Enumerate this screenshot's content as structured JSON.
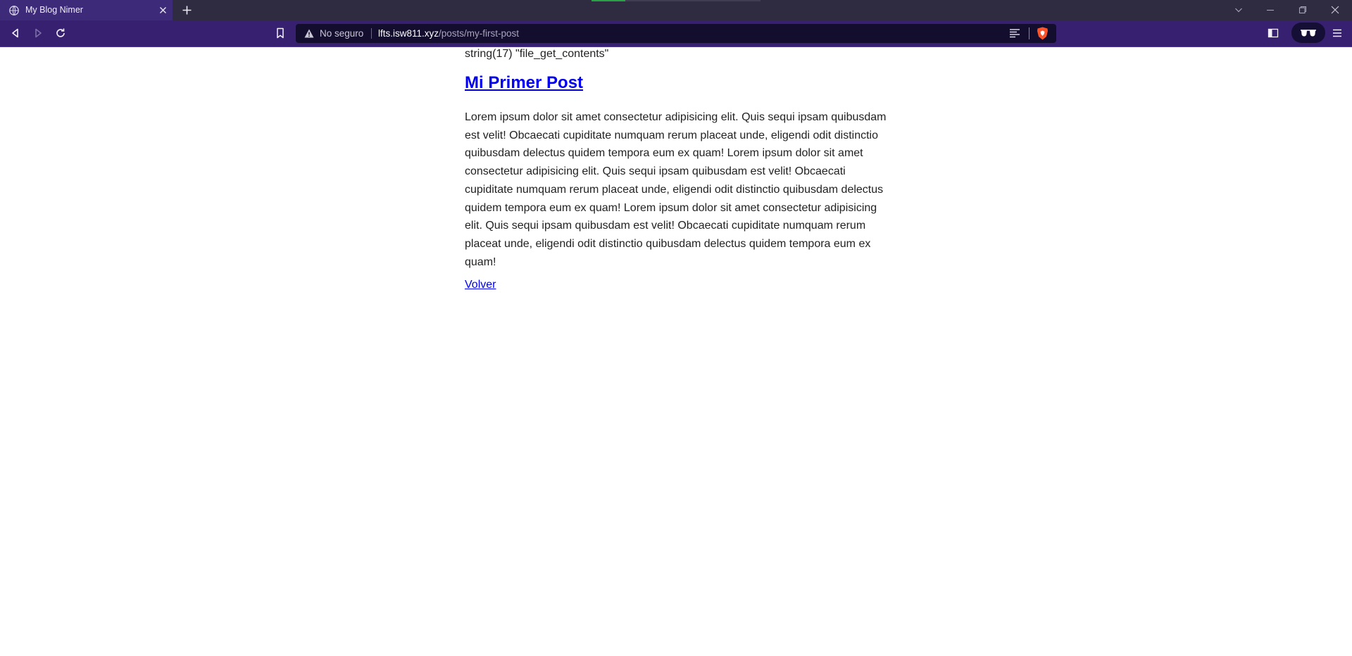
{
  "browser": {
    "tab": {
      "title": "My Blog Nimer",
      "favicon": "globe-icon"
    },
    "urlbar": {
      "security_label": "No seguro",
      "host": "lfts.isw811.xyz",
      "path": "/posts/my-first-post"
    },
    "colors": {
      "tabstrip": "#2f2c41",
      "active_tab": "#3d2a78",
      "toolbar": "#36206f",
      "urlbar": "#130d2e",
      "brave_accent": "#fb542b"
    }
  },
  "page": {
    "debug_output": "string(17) \"file_get_contents\"",
    "post": {
      "title": "Mi Primer Post",
      "body": "Lorem ipsum dolor sit amet consectetur adipisicing elit. Quis sequi ipsam quibusdam est velit! Obcaecati cupiditate numquam rerum placeat unde, eligendi odit distinctio quibusdam delectus quidem tempora eum ex quam! Lorem ipsum dolor sit amet consectetur adipisicing elit. Quis sequi ipsam quibusdam est velit! Obcaecati cupiditate numquam rerum placeat unde, eligendi odit distinctio quibusdam delectus quidem tempora eum ex quam! Lorem ipsum dolor sit amet consectetur adipisicing elit. Quis sequi ipsam quibusdam est velit! Obcaecati cupiditate numquam rerum placeat unde, eligendi odit distinctio quibusdam delectus quidem tempora eum ex quam!"
    },
    "back_link": "Volver",
    "colors": {
      "link": "#0000ee",
      "text": "#222222"
    }
  }
}
